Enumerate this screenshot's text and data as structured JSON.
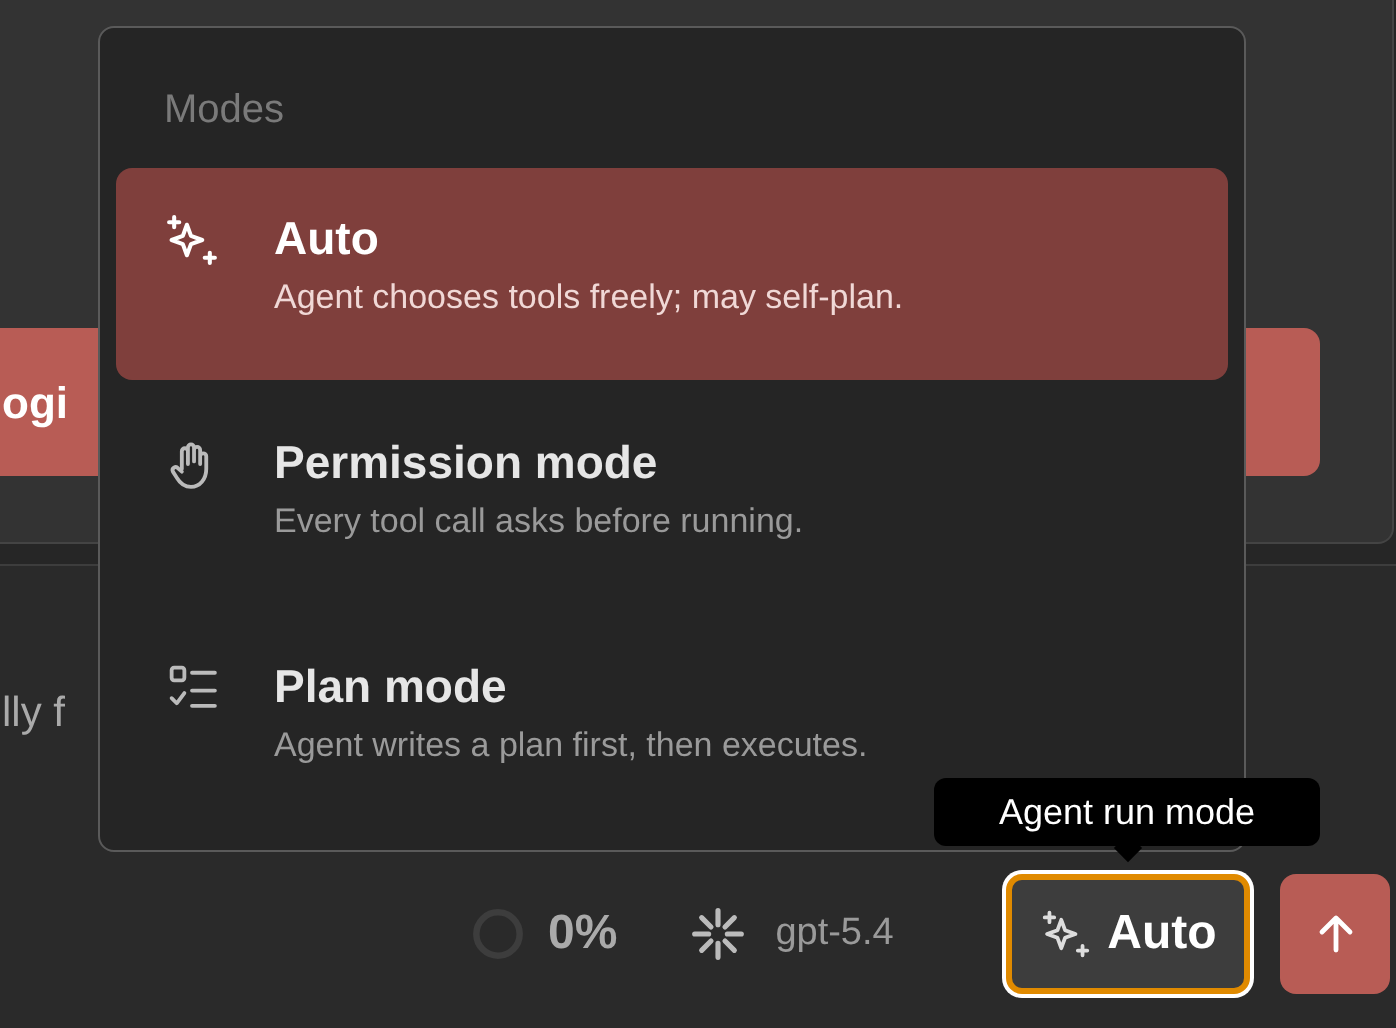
{
  "background": {
    "button_label": "ogi",
    "text_fragment": "lly f"
  },
  "menu": {
    "heading": "Modes",
    "items": [
      {
        "kind": "sparkle",
        "title": "Auto",
        "description": "Agent chooses tools freely; may self-plan.",
        "selected": true
      },
      {
        "kind": "hand",
        "title": "Permission mode",
        "description": "Every tool call asks before running.",
        "selected": false
      },
      {
        "kind": "checklist",
        "title": "Plan mode",
        "description": "Agent writes a plan first, then executes.",
        "selected": false
      }
    ]
  },
  "tooltip": "Agent run mode",
  "toolbar": {
    "context": "0%",
    "model": "gpt-5.4",
    "mode_button": {
      "label": "Auto",
      "focused": true
    }
  }
}
